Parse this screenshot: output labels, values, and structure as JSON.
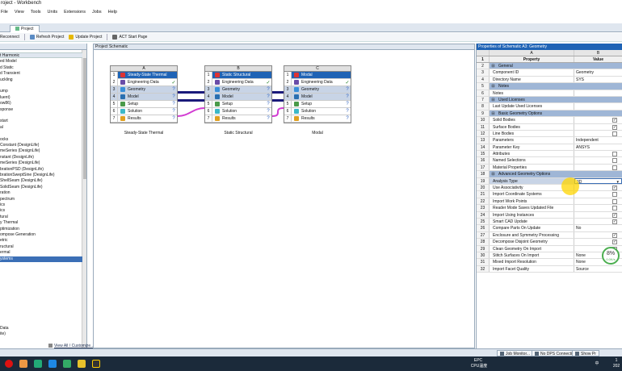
{
  "window": {
    "title": "roject - Workbench"
  },
  "menu": [
    "File",
    "View",
    "Tools",
    "Units",
    "Extensions",
    "Jobs",
    "Help"
  ],
  "tabs": [
    {
      "label": "Project"
    }
  ],
  "toolbar": {
    "reconnect_label": "Reconnect",
    "refresh_label": "Refresh Project",
    "update_label": "Update Project",
    "act_label": "ACT Start Page"
  },
  "toolbox": {
    "items": [
      {
        "label": "t Harmonic"
      },
      {
        "label": "ed Model"
      },
      {
        "label": "d Static"
      },
      {
        "label": "d Transient"
      },
      {
        "label": "uckling"
      },
      {
        "label": ""
      },
      {
        "label": "ump"
      },
      {
        "label": "luent)"
      },
      {
        "label": "ow86)"
      },
      {
        "label": "sponse"
      },
      {
        "label": ""
      },
      {
        "label": "start"
      },
      {
        "label": "al"
      },
      {
        "label": ""
      },
      {
        "label": "ocks"
      },
      {
        "label": "Constant (DesignLife)"
      },
      {
        "label": "meSeries (DesignLife)"
      },
      {
        "label": "nstant (DesignLife)"
      },
      {
        "label": "meSeries (DesignLife)"
      },
      {
        "label": "brationPSD (DesignLife)"
      },
      {
        "label": "brationSweptSine (DesignLife)"
      },
      {
        "label": "ShellSeam (DesignLife)"
      },
      {
        "label": "SolidSeam (DesignLife)"
      },
      {
        "label": "ration"
      },
      {
        "label": "pectrum"
      },
      {
        "label": "ics"
      },
      {
        "label": "ics"
      },
      {
        "label": "tural"
      },
      {
        "label": "y Thermal"
      },
      {
        "label": "ptimization"
      },
      {
        "label": "ompose Generation"
      },
      {
        "label": "etric"
      },
      {
        "label": "ructural"
      },
      {
        "label": "ermal"
      },
      {
        "label": "ystems"
      }
    ],
    "footer_items": [
      {
        "label": "Data"
      },
      {
        "label": "ite)"
      }
    ],
    "view_all_label": "View All / Customize..."
  },
  "schematic": {
    "title": "Project Schematic",
    "systems": [
      {
        "col": "A",
        "caption": "Steady-State Thermal",
        "rows": [
          {
            "n": "1",
            "label": "Steady-State Thermal",
            "icon": "thermal-icon",
            "status": ""
          },
          {
            "n": "2",
            "label": "Engineering Data",
            "icon": "engineering-data-icon",
            "status": "✓"
          },
          {
            "n": "3",
            "label": "Geometry",
            "icon": "geometry-icon",
            "status": "?"
          },
          {
            "n": "4",
            "label": "Model",
            "icon": "model-icon",
            "status": "?"
          },
          {
            "n": "5",
            "label": "Setup",
            "icon": "setup-icon",
            "status": "?"
          },
          {
            "n": "6",
            "label": "Solution",
            "icon": "solution-icon",
            "status": "?"
          },
          {
            "n": "7",
            "label": "Results",
            "icon": "results-icon",
            "status": "?"
          }
        ]
      },
      {
        "col": "B",
        "caption": "Static Structural",
        "rows": [
          {
            "n": "1",
            "label": "Static Structural",
            "icon": "structural-icon",
            "status": ""
          },
          {
            "n": "2",
            "label": "Engineering Data",
            "icon": "engineering-data-icon",
            "status": "✓"
          },
          {
            "n": "3",
            "label": "Geometry",
            "icon": "geometry-icon",
            "status": "?"
          },
          {
            "n": "4",
            "label": "Model",
            "icon": "model-icon",
            "status": "?"
          },
          {
            "n": "5",
            "label": "Setup",
            "icon": "setup-icon",
            "status": "?"
          },
          {
            "n": "6",
            "label": "Solution",
            "icon": "solution-icon",
            "status": "?"
          },
          {
            "n": "7",
            "label": "Results",
            "icon": "results-icon",
            "status": "?"
          }
        ]
      },
      {
        "col": "C",
        "caption": "Modal",
        "rows": [
          {
            "n": "1",
            "label": "Modal",
            "icon": "modal-icon",
            "status": ""
          },
          {
            "n": "2",
            "label": "Engineering Data",
            "icon": "engineering-data-icon",
            "status": "✓"
          },
          {
            "n": "3",
            "label": "Geometry",
            "icon": "geometry-icon",
            "status": "?"
          },
          {
            "n": "4",
            "label": "Model",
            "icon": "model-icon",
            "status": "?"
          },
          {
            "n": "5",
            "label": "Setup",
            "icon": "setup-icon",
            "status": "?"
          },
          {
            "n": "6",
            "label": "Solution",
            "icon": "solution-icon",
            "status": "?"
          },
          {
            "n": "7",
            "label": "Results",
            "icon": "results-icon",
            "status": "?"
          }
        ]
      }
    ]
  },
  "properties": {
    "title": "Properties of Schematic A3: Geometry",
    "col_a": "A",
    "col_b": "B",
    "col_property": "Property",
    "col_value": "Value",
    "rows": [
      {
        "n": "2",
        "group": true,
        "label": "General"
      },
      {
        "n": "3",
        "label": "Component ID",
        "value": "Geometry"
      },
      {
        "n": "4",
        "label": "Directory Name",
        "value": "SYS"
      },
      {
        "n": "5",
        "group": true,
        "label": "Notes"
      },
      {
        "n": "6",
        "label": "Notes",
        "value": ""
      },
      {
        "n": "7",
        "group": true,
        "label": "Used Licenses"
      },
      {
        "n": "8",
        "label": "Last Update Used Licenses",
        "value": ""
      },
      {
        "n": "9",
        "group": true,
        "label": "Basic Geometry Options"
      },
      {
        "n": "10",
        "label": "Solid Bodies",
        "check": true
      },
      {
        "n": "11",
        "label": "Surface Bodies",
        "check": true
      },
      {
        "n": "12",
        "label": "Line Bodies",
        "check": false
      },
      {
        "n": "13",
        "label": "Parameters",
        "value": "Independent"
      },
      {
        "n": "14",
        "label": "Parameter Key",
        "value": "ANSYS"
      },
      {
        "n": "15",
        "label": "Attributes",
        "check": false
      },
      {
        "n": "16",
        "label": "Named Selections",
        "check": false
      },
      {
        "n": "17",
        "label": "Material Properties",
        "check": false
      },
      {
        "n": "18",
        "group": true,
        "label": "Advanced Geometry Options"
      },
      {
        "n": "19",
        "label": "Analysis Type",
        "value": "3D",
        "selected": true
      },
      {
        "n": "20",
        "label": "Use Associativity",
        "check": true
      },
      {
        "n": "21",
        "label": "Import Coordinate Systems",
        "check": false
      },
      {
        "n": "22",
        "label": "Import Work Points",
        "check": false
      },
      {
        "n": "23",
        "label": "Reader Mode Saves Updated File",
        "check": false
      },
      {
        "n": "24",
        "label": "Import Using Instances",
        "check": true
      },
      {
        "n": "25",
        "label": "Smart CAD Update",
        "check": true
      },
      {
        "n": "26",
        "label": "Compare Parts On Update",
        "value": "No"
      },
      {
        "n": "27",
        "label": "Enclosure and Symmetry Processing",
        "check": true
      },
      {
        "n": "28",
        "label": "Decompose Disjoint Geometry",
        "check": true
      },
      {
        "n": "29",
        "label": "Clean Geometry On Import",
        "check": false
      },
      {
        "n": "30",
        "label": "Stitch Surfaces On Import",
        "value": "None"
      },
      {
        "n": "31",
        "label": "Mixed Import Resolution",
        "value": "None"
      },
      {
        "n": "32",
        "label": "Import Facet Quality",
        "value": "Source"
      }
    ]
  },
  "badge": {
    "percent": "8%",
    "speed": "0.0K/s"
  },
  "status_tabs": [
    {
      "label": "Job Monitor..."
    },
    {
      "label": "No DPS Connection"
    },
    {
      "label": "Show Pr"
    }
  ],
  "taskbar": {
    "tray_text_1": "EPC",
    "tray_text_2": "CPU温度",
    "lang": "中",
    "clock_top": "1",
    "clock_bottom": "202"
  },
  "colors": {
    "accent": "#1f63b5",
    "group_row": "#9fb6d6",
    "link": "#1a1a7a",
    "link_magenta": "#d23cd2"
  }
}
